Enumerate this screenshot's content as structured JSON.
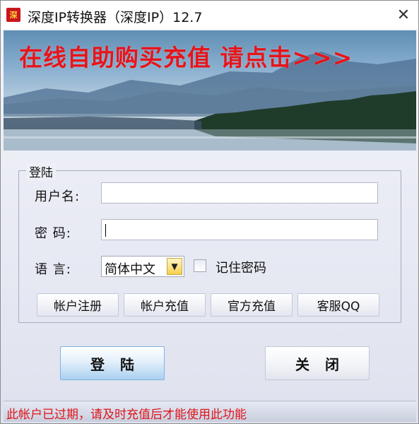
{
  "window": {
    "title": "深度IP转换器（深度IP）12.7",
    "close_glyph": "✕",
    "app_icon_glyph": "深"
  },
  "banner": {
    "text": "在线自助购买充值  请点击>>>"
  },
  "login_group": {
    "legend": "登陆",
    "username_label": "用户名:",
    "username_value": "",
    "password_label": "密  码:",
    "password_value": "",
    "language_label": "语  言:",
    "language_selected": "简体中文",
    "remember_label": "记住密码",
    "remember_checked": false
  },
  "buttons": {
    "register": "帐户注册",
    "recharge": "帐户充值",
    "official_recharge": "官方充值",
    "support_qq": "客服QQ",
    "login": "登陆",
    "close": "关闭"
  },
  "status": {
    "message": "此帐户已过期，请及时充值后才能使用此功能"
  },
  "colors": {
    "banner_text": "#e8141a",
    "status_text": "#e0141a",
    "login_button": "#a9d0f0"
  },
  "icons": [
    "app-icon",
    "close-icon",
    "dropdown-arrow-icon"
  ]
}
